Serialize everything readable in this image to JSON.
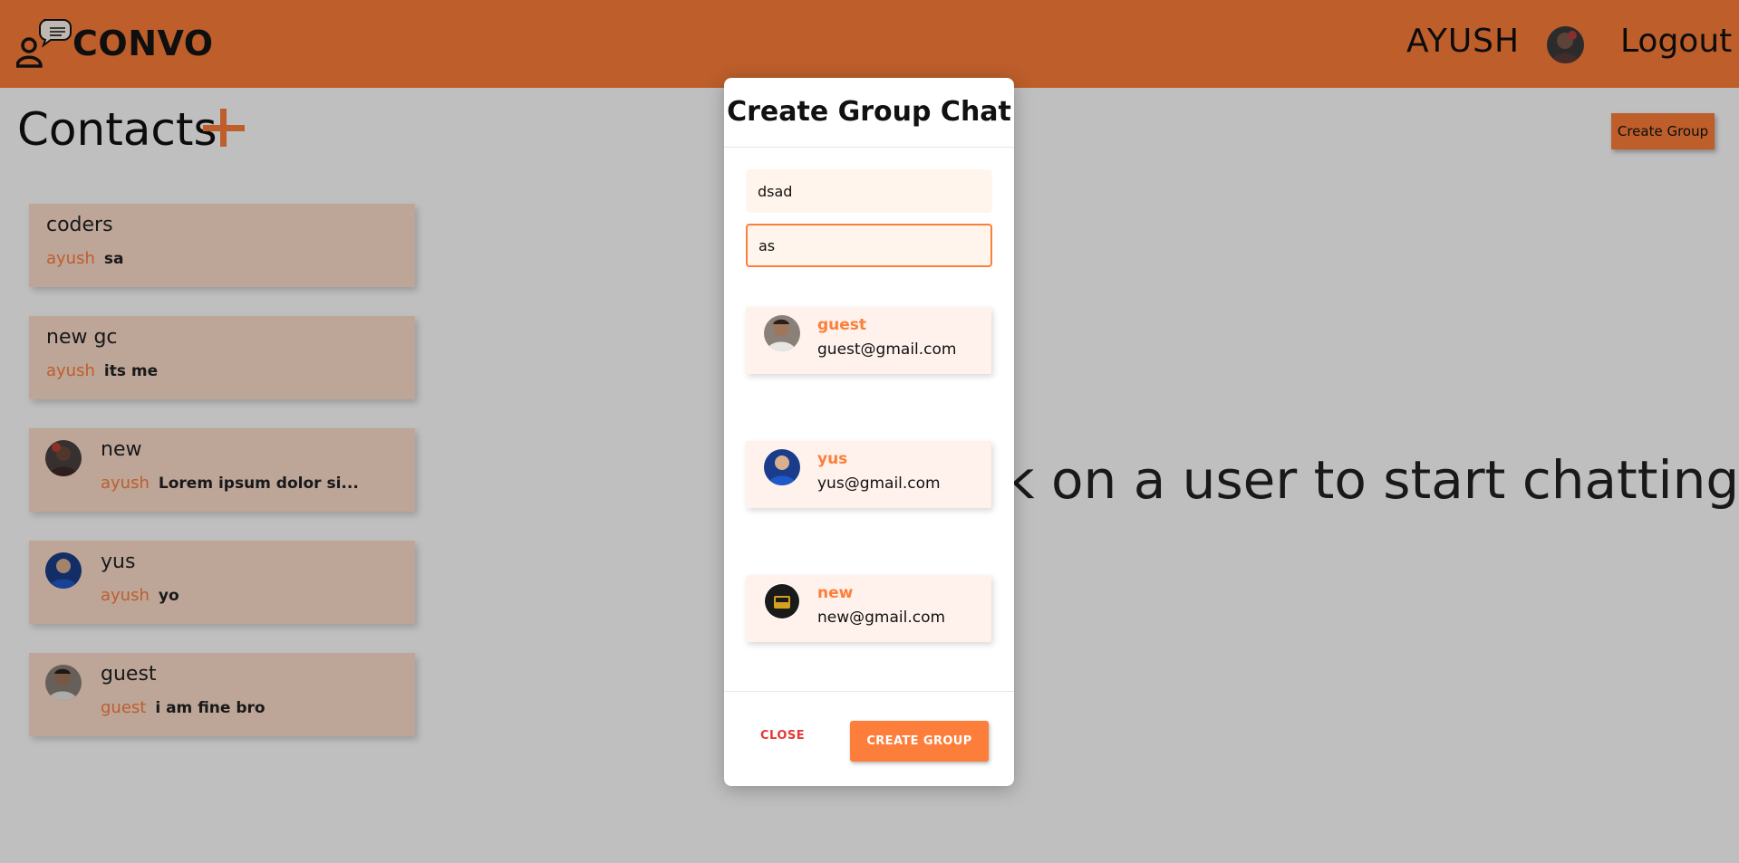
{
  "header": {
    "brand": "CONVO",
    "username": "AYUSH",
    "logout_label": "Logout"
  },
  "contacts": {
    "title": "Contacts",
    "items": [
      {
        "name": "coders",
        "sender": "ayush",
        "message": "sa"
      },
      {
        "name": "new gc",
        "sender": "ayush",
        "message": "its me"
      },
      {
        "name": "new",
        "sender": "ayush",
        "message": "Lorem ipsum dolor si..."
      },
      {
        "name": "yus",
        "sender": "ayush",
        "message": "yo"
      },
      {
        "name": "guest",
        "sender": "guest",
        "message": "i am fine bro"
      }
    ]
  },
  "create_group_button": "Create Group",
  "empty_state": "k on a user to start chatting",
  "modal": {
    "title": "Create Group Chat",
    "group_name_value": "dsad",
    "search_value": "as",
    "results": [
      {
        "name": "guest",
        "email": "guest@gmail.com"
      },
      {
        "name": "yus",
        "email": "yus@gmail.com"
      },
      {
        "name": "new",
        "email": "new@gmail.com"
      }
    ],
    "close_label": "CLOSE",
    "create_label": "CREATE GROUP"
  },
  "colors": {
    "accent": "#fd7e3a",
    "card_bg": "#fcdccb",
    "close_red": "#e53935"
  },
  "icons": {
    "logo": "user-chat-bubble-icon",
    "add": "plus-icon"
  }
}
